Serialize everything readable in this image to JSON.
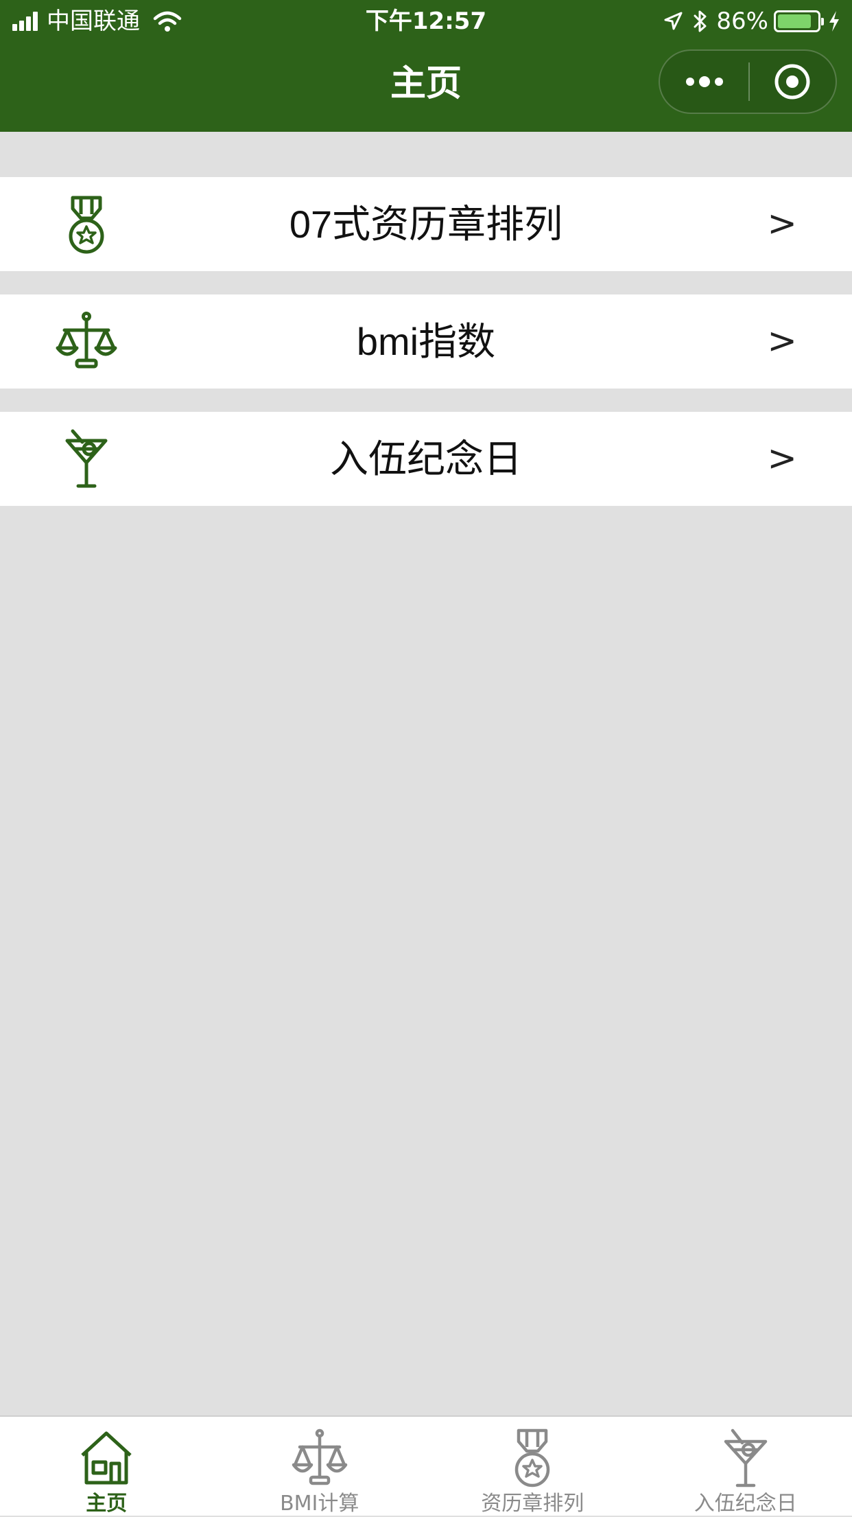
{
  "status_bar": {
    "carrier": "中国联通",
    "time": "下午12:57",
    "battery_percent": "86%",
    "battery_level": 0.86,
    "icons": [
      "signal-icon",
      "wifi-icon",
      "location-icon",
      "bluetooth-icon",
      "battery-icon",
      "charging-icon"
    ]
  },
  "nav": {
    "title": "主页",
    "capsule_icons": [
      "more-icon",
      "close-target-icon"
    ]
  },
  "menu": {
    "items": [
      {
        "label": "07式资历章排列",
        "arrow": ">",
        "icon": "medal-icon"
      },
      {
        "label": "bmi指数",
        "arrow": ">",
        "icon": "scale-icon"
      },
      {
        "label": "入伍纪念日",
        "arrow": ">",
        "icon": "cocktail-icon"
      }
    ]
  },
  "tabbar": {
    "tabs": [
      {
        "label": "主页",
        "icon": "home-icon",
        "active": true
      },
      {
        "label": "BMI计算",
        "icon": "scale-icon",
        "active": false
      },
      {
        "label": "资历章排列",
        "icon": "medal-icon",
        "active": false
      },
      {
        "label": "入伍纪念日",
        "icon": "cocktail-icon",
        "active": false
      }
    ]
  },
  "colors": {
    "primary": "#2d6219",
    "background": "#e0e0e0",
    "tab_inactive": "#8a8a8a",
    "battery": "#7ed46a"
  }
}
